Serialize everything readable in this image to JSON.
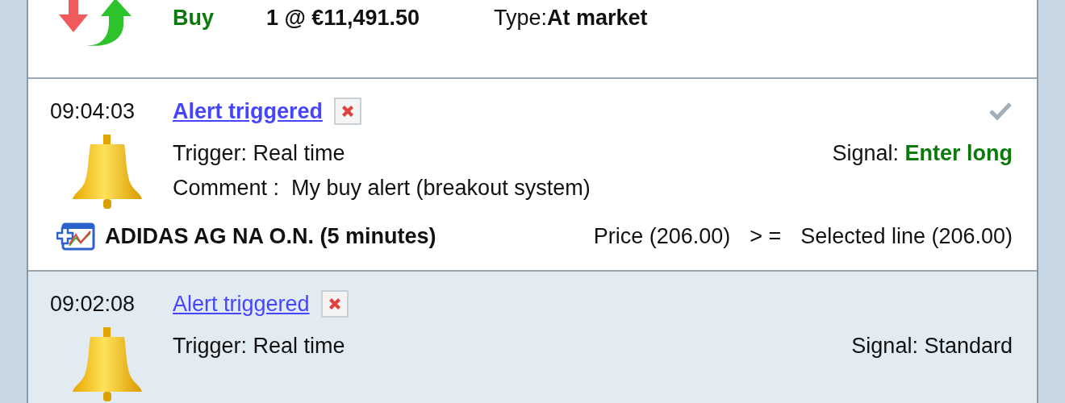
{
  "order": {
    "side": "Buy",
    "quantity_price": "1 @ €11,491.50",
    "type": "Type:**At market**"
  },
  "alerts": [
    {
      "time": "09:04:03",
      "title": "Alert triggered",
      "unread": true,
      "acknowledged": true,
      "selected": false,
      "trigger": "Trigger: Real time",
      "signal_label": "Signal:",
      "signal": "Enter long",
      "signal_emphasized": true,
      "comment": "Comment :  My buy alert (breakout system)",
      "instrument": "ADIDAS AG NA O.N. (5 minutes)",
      "condition_left": "Price (206.00)",
      "operator": "> =",
      "condition_right": "Selected line (206.00)"
    },
    {
      "time": "09:02:08",
      "title": "Alert triggered",
      "unread": false,
      "acknowledged": false,
      "selected": true,
      "trigger": "Trigger: Real time",
      "signal_label": "Signal:",
      "signal": "Standard",
      "signal_emphasized": false
    }
  ]
}
